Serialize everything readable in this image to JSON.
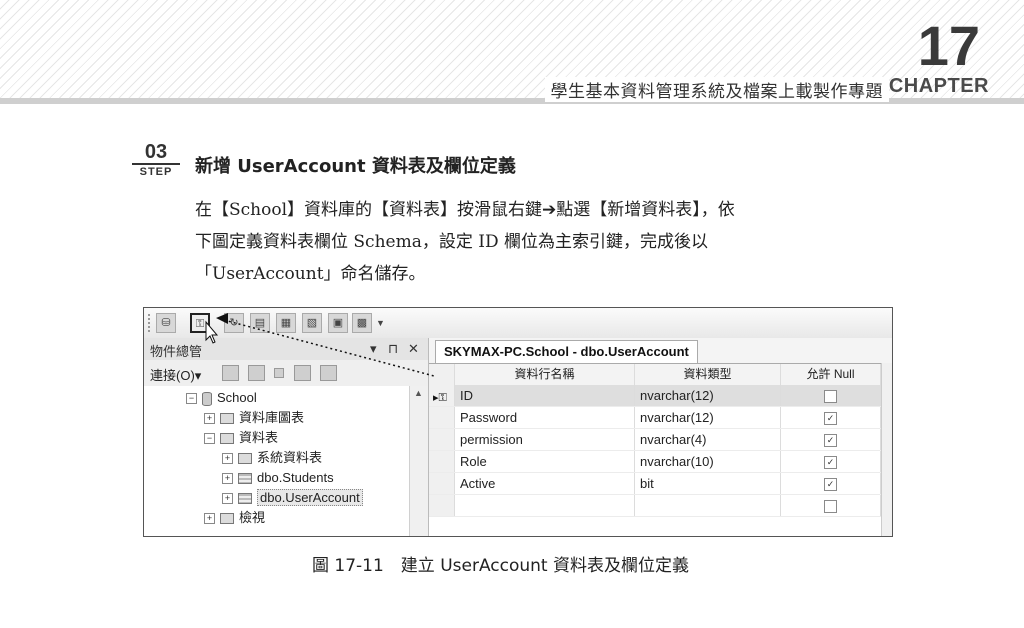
{
  "header": {
    "chapter_number": "17",
    "book_title": "學生基本資料管理系統及檔案上載製作專題",
    "chapter_word": "CHAPTER"
  },
  "step": {
    "number": "03",
    "word": "STEP",
    "title": "新增 UserAccount 資料表及欄位定義"
  },
  "body": {
    "line1": "在【School】資料庫的【資料表】按滑鼠右鍵➔點選【新增資料表】，依",
    "line2": "下圖定義資料表欄位 Schema，設定 ID 欄位為主索引鍵，完成後以",
    "line3": "「UserAccount」命名儲存。"
  },
  "screenshot": {
    "object_explorer": {
      "title": "物件總管",
      "pin_glyph": "▾ ⊓ ✕",
      "connect_label": "連接(O)▾",
      "tree": [
        {
          "label": "School",
          "expander": "⊟",
          "icon": "database-icon",
          "level": 0
        },
        {
          "label": "資料庫圖表",
          "expander": "⊞",
          "icon": "folder-icon",
          "level": 1
        },
        {
          "label": "資料表",
          "expander": "⊟",
          "icon": "folder-icon",
          "level": 1
        },
        {
          "label": "系統資料表",
          "expander": "⊞",
          "icon": "folder-icon",
          "level": 2
        },
        {
          "label": "dbo.Students",
          "expander": "⊞",
          "icon": "table-icon",
          "level": 2
        },
        {
          "label": "dbo.UserAccount",
          "expander": "⊞",
          "icon": "table-icon",
          "level": 2
        },
        {
          "label": "檢視",
          "expander": "⊞",
          "icon": "folder-icon",
          "level": 1
        }
      ]
    },
    "designer": {
      "tab_label": "SKYMAX-PC.School - dbo.UserAccount",
      "columns": [
        "資料行名稱",
        "資料類型",
        "允許 Null"
      ],
      "rows": [
        {
          "name": "ID",
          "type": "nvarchar(12)",
          "allow_null": false,
          "primary_key": true
        },
        {
          "name": "Password",
          "type": "nvarchar(12)",
          "allow_null": true,
          "primary_key": false
        },
        {
          "name": "permission",
          "type": "nvarchar(4)",
          "allow_null": true,
          "primary_key": false
        },
        {
          "name": "Role",
          "type": "nvarchar(10)",
          "allow_null": true,
          "primary_key": false
        },
        {
          "name": "Active",
          "type": "bit",
          "allow_null": true,
          "primary_key": false
        },
        {
          "name": "",
          "type": "",
          "allow_null": false,
          "primary_key": false
        }
      ]
    }
  },
  "caption": "圖 17-11　建立 UserAccount 資料表及欄位定義"
}
